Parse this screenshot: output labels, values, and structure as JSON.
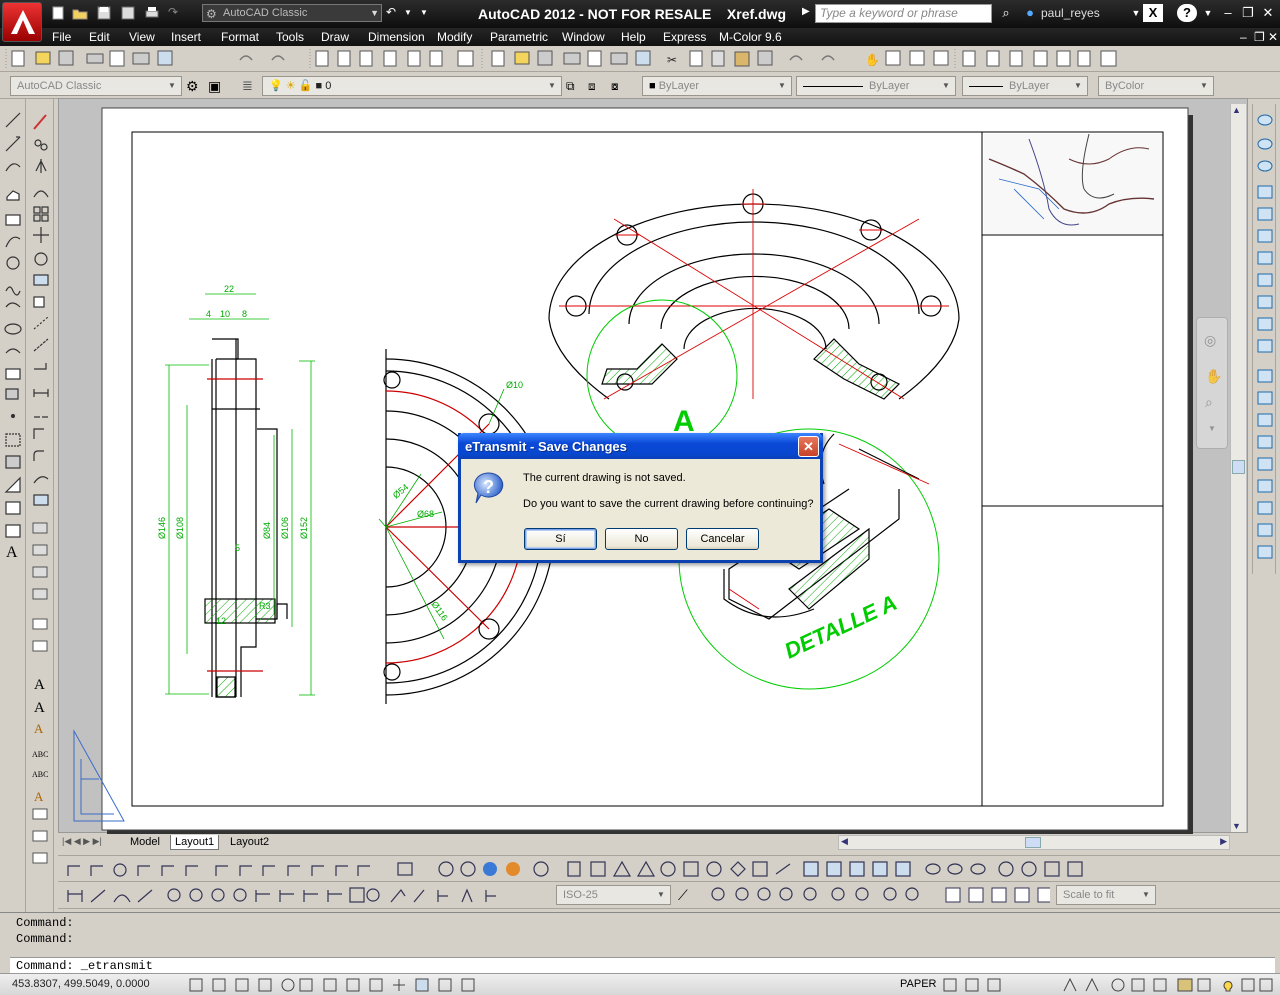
{
  "title_bar": {
    "app_title": "AutoCAD 2012 - NOT FOR RESALE    Xref.dwg",
    "workspace": "AutoCAD Classic",
    "search_placeholder": "Type a keyword or phrase",
    "user": "paul_reyes"
  },
  "menu": [
    "File",
    "Edit",
    "View",
    "Insert",
    "Format",
    "Tools",
    "Draw",
    "Dimension",
    "Modify",
    "Parametric",
    "Window",
    "Help",
    "Express",
    "M-Color 9.6"
  ],
  "properties_bar": {
    "workspace": "AutoCAD Classic",
    "layer": "0",
    "color": "ByLayer",
    "linetype": "ByLayer",
    "lineweight": "ByLayer",
    "plotstyle": "ByColor"
  },
  "drawing": {
    "dimensions": {
      "top": "22",
      "sub1": "4",
      "sub2": "10",
      "sub3": "8",
      "d146": "Ø146",
      "d108": "Ø108",
      "d84": "Ø84",
      "d106": "Ø106",
      "d152": "Ø152",
      "d5": "5",
      "d12": "12",
      "r3": "R3",
      "d10": "Ø10",
      "d54": "Ø54",
      "d68": "Ø68",
      "d116": "Ø116"
    },
    "label_a": "A",
    "label_detail": "DETALLE  A"
  },
  "layout_tabs": [
    "Model",
    "Layout1",
    "Layout2"
  ],
  "active_tab": "Layout1",
  "dimstyle": "ISO-25",
  "scale": "Scale to fit",
  "command": {
    "history": [
      "Command:",
      "Command:"
    ],
    "current": "Command:  _etransmit"
  },
  "status": {
    "coords": "453.8307, 499.5049, 0.0000",
    "space": "PAPER"
  },
  "dialog": {
    "title": "eTransmit - Save Changes",
    "message1": "The current drawing is not saved.",
    "message2": "Do you want to save the current drawing before continuing?",
    "buttons": {
      "yes": "Sí",
      "no": "No",
      "cancel": "Cancelar"
    }
  },
  "colors": {
    "dialog_title": "#0848d0",
    "dim_green": "#00c000",
    "center_red": "#e00000"
  }
}
